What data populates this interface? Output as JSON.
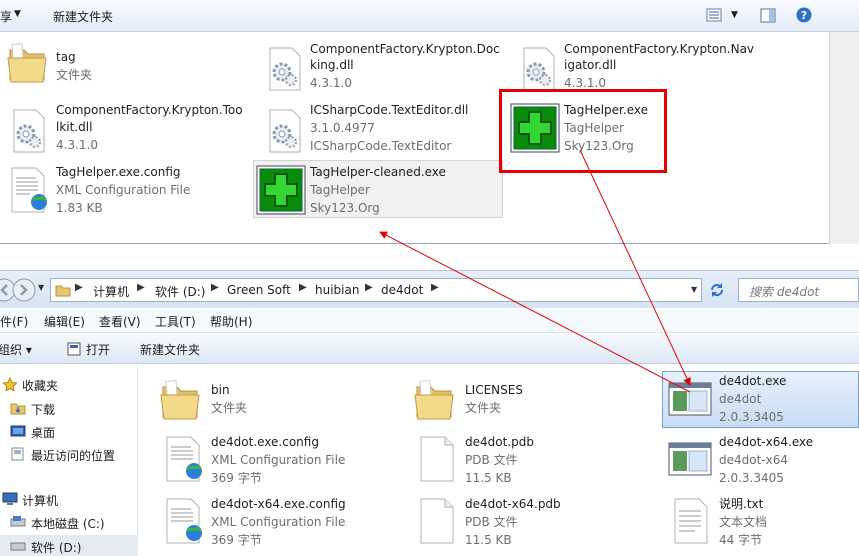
{
  "top_window": {
    "toolbar": {
      "share_label": "享",
      "new_folder_label": "新建文件夹"
    },
    "files": [
      {
        "name": "tag",
        "sub1": "文件夹",
        "sub2": ""
      },
      {
        "name": "ComponentFactory.Krypton.Doc",
        "name2": "king.dll",
        "sub1": "4.3.1.0",
        "sub2": ""
      },
      {
        "name": "ComponentFactory.Krypton.Nav",
        "name2": "igator.dll",
        "sub1": "4.3.1.0",
        "sub2": ""
      },
      {
        "name": "ComponentFactory.Krypton.Too",
        "name2": "lkit.dll",
        "sub1": "4.3.1.0",
        "sub2": ""
      },
      {
        "name": "ICSharpCode.TextEditor.dll",
        "sub1": "3.1.0.4977",
        "sub2": "ICSharpCode.TextEditor"
      },
      {
        "name": "TagHelper.exe",
        "sub1": "TagHelper",
        "sub2": "Sky123.Org"
      },
      {
        "name": "TagHelper.exe.config",
        "sub1": "XML Configuration File",
        "sub2": "1.83 KB"
      },
      {
        "name": "TagHelper-cleaned.exe",
        "sub1": "TagHelper",
        "sub2": "Sky123.Org"
      }
    ]
  },
  "bottom_window": {
    "breadcrumbs": [
      "计算机",
      "软件 (D:)",
      "Green Soft",
      "huibian",
      "de4dot"
    ],
    "search_placeholder": "搜索 de4dot",
    "menu": [
      "文件(F)",
      "编辑(E)",
      "查看(V)",
      "工具(T)",
      "帮助(H)"
    ],
    "commands": {
      "organize": "组织 ▾",
      "open": "打开",
      "new_folder": "新建文件夹"
    },
    "nav": {
      "favorites": "收藏夹",
      "downloads": "下载",
      "desktop": "桌面",
      "recent": "最近访问的位置",
      "computer": "计算机",
      "local_c": "本地磁盘 (C:)",
      "soft_d": "软件 (D:)"
    },
    "files": [
      {
        "name": "bin",
        "sub1": "文件夹",
        "sub2": ""
      },
      {
        "name": "LICENSES",
        "sub1": "文件夹",
        "sub2": ""
      },
      {
        "name": "de4dot.exe",
        "sub1": "de4dot",
        "sub2": "2.0.3.3405"
      },
      {
        "name": "de4dot.exe.config",
        "sub1": "XML Configuration File",
        "sub2": "369 字节"
      },
      {
        "name": "de4dot.pdb",
        "sub1": "PDB 文件",
        "sub2": "11.5 KB"
      },
      {
        "name": "de4dot-x64.exe",
        "sub1": "de4dot-x64",
        "sub2": "2.0.3.3405"
      },
      {
        "name": "de4dot-x64.exe.config",
        "sub1": "XML Configuration File",
        "sub2": "369 字节"
      },
      {
        "name": "de4dot-x64.pdb",
        "sub1": "PDB 文件",
        "sub2": "11.5 KB"
      },
      {
        "name": "说明.txt",
        "sub1": "文本文档",
        "sub2": "44 字节"
      }
    ]
  },
  "colors": {
    "annotation_red": "#e60000",
    "selection_blue": "#c7ddf5",
    "green_plus": "#1fb81f"
  }
}
